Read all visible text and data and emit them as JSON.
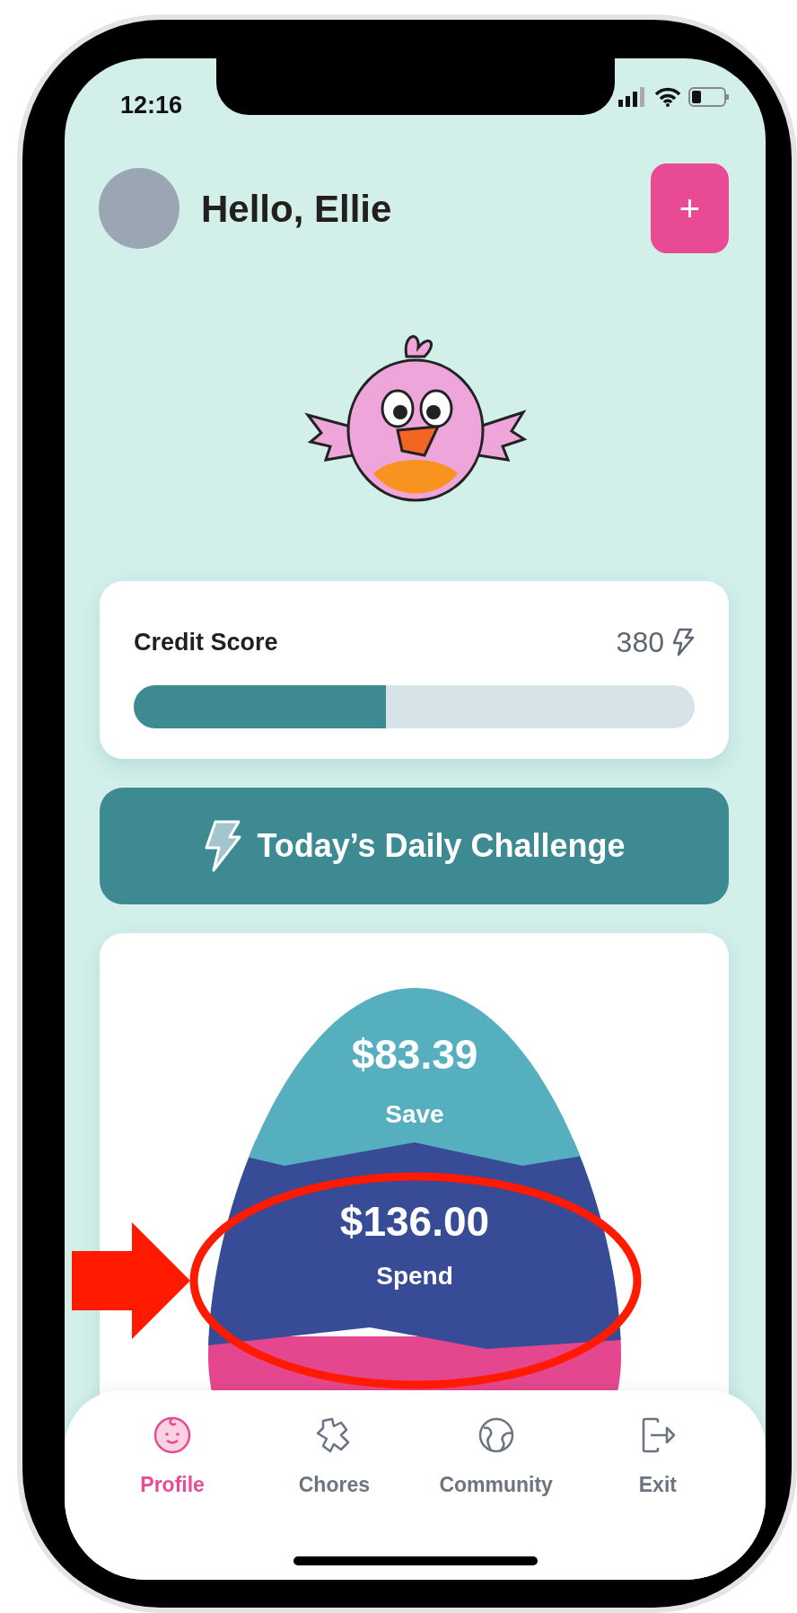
{
  "status_bar": {
    "time": "12:16"
  },
  "header": {
    "greeting": "Hello, Ellie",
    "add_button": "+"
  },
  "credit_score": {
    "label": "Credit Score",
    "value": "380",
    "level": 0.45
  },
  "daily_challenge": {
    "label": "Today’s Daily Challenge"
  },
  "balances": [
    {
      "amount": "$83.39",
      "label": "Save",
      "color": "#56afbf",
      "highlighted": false
    },
    {
      "amount": "$136.00",
      "label": "Spend",
      "color": "#374b96",
      "highlighted": true
    },
    {
      "color": "#e5478f",
      "highlighted": false
    }
  ],
  "tabs": [
    {
      "label": "Profile",
      "selected": true
    },
    {
      "label": "Chores",
      "selected": false
    },
    {
      "label": "Community",
      "selected": false
    },
    {
      "label": "Exit",
      "selected": false
    }
  ]
}
